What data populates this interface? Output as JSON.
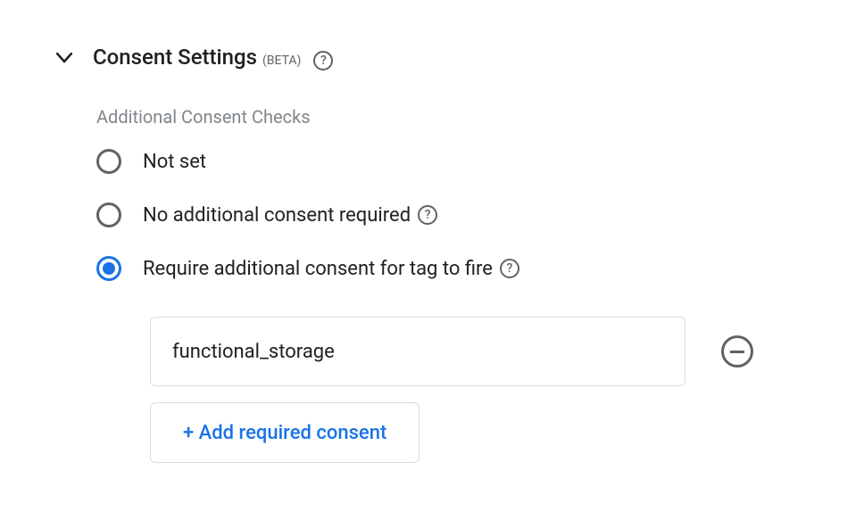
{
  "section": {
    "title": "Consent Settings",
    "beta_label": "(BETA)"
  },
  "subsection": {
    "label": "Additional Consent Checks"
  },
  "radio_options": {
    "not_set": "Not set",
    "no_additional": "No additional consent required",
    "require_additional": "Require additional consent for tag to fire"
  },
  "consent_input": {
    "value": "functional_storage"
  },
  "add_button": {
    "label": "+ Add required consent"
  },
  "help_glyph": "?"
}
